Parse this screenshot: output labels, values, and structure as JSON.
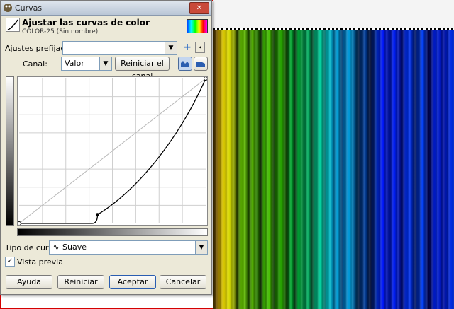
{
  "dialog": {
    "title": "Curvas",
    "heading": "Ajustar las curvas de color",
    "subheading": "COLOR-25 (Sin nombre)"
  },
  "presets": {
    "label": "Ajustes prefijados:",
    "value": ""
  },
  "channel": {
    "label": "Canal:",
    "value": "Valor",
    "reset_label": "Reiniciar el canal"
  },
  "curve_type": {
    "label": "Tipo de curva:",
    "value": "Suave"
  },
  "preview": {
    "label": "Vista previa",
    "checked": true
  },
  "buttons": {
    "help": "Ayuda",
    "reset": "Reiniciar",
    "ok": "Aceptar",
    "cancel": "Cancelar"
  },
  "icons": {
    "add": "plus-icon",
    "presets_menu": "menu-icon",
    "linear_histogram": "linear-histogram-icon",
    "log_histogram": "log-histogram-icon",
    "curve_type": "curve-icon"
  },
  "curve": {
    "points": [
      [
        0,
        0
      ],
      [
        0.42,
        0.06
      ],
      [
        1,
        1
      ]
    ]
  },
  "colors": {
    "accent": "#d40000"
  }
}
